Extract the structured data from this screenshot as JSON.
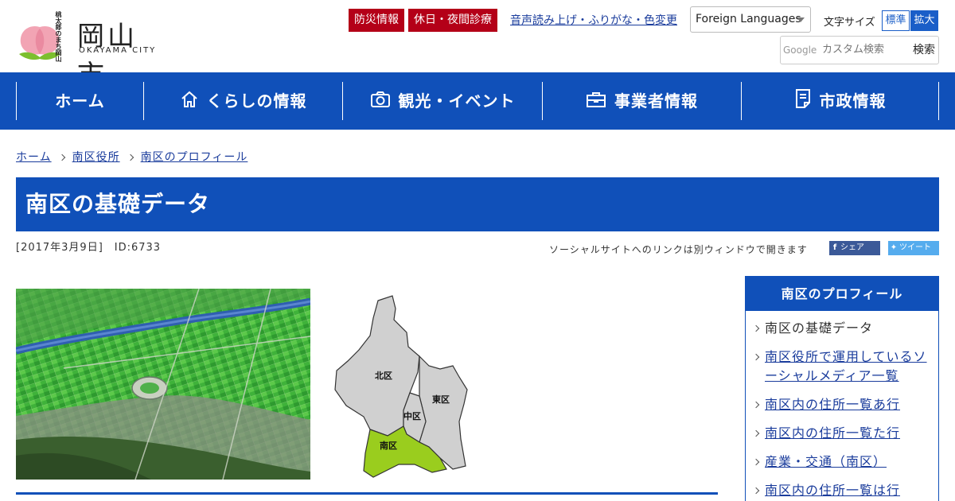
{
  "header": {
    "logo_city": "岡山市",
    "logo_en": "OKAYAMA CITY",
    "logo_vertical": "桃太郎のまち岡山",
    "disaster_label": "防災情報",
    "holiday_label": "休日・夜間診療",
    "voice_label": "音声読み上げ・ふりがな・色変更",
    "lang_label": "Foreign Languages",
    "fontsize_label": "文字サイズ",
    "fontsize_std": "標準",
    "fontsize_big": "拡大",
    "search_brand": "Google",
    "search_placeholder": "カスタム検索",
    "search_button": "検索"
  },
  "nav": {
    "home": "ホーム",
    "life": "くらしの情報",
    "tourism": "観光・イベント",
    "business": "事業者情報",
    "city": "市政情報"
  },
  "breadcrumb": [
    "ホーム",
    "南区役所",
    "南区のプロフィール"
  ],
  "page": {
    "title": "南区の基礎データ",
    "meta": "[2017年3月9日]　ID:6733",
    "social_note": "ソーシャルサイトへのリンクは別ウィンドウで開きます",
    "share_fb": "シェア",
    "share_tw": "ツイート"
  },
  "map": {
    "labels": [
      "北区",
      "東区",
      "中区",
      "南区"
    ],
    "colors": {
      "other": "#d0d0d0",
      "highlight": "#9acd1e"
    }
  },
  "sidebar": {
    "title": "南区のプロフィール",
    "items": [
      "南区の基礎データ",
      "南区役所で運用しているソーシャルメディア一覧",
      "南区内の住所一覧あ行",
      "南区内の住所一覧た行",
      "産業・交通（南区）",
      "南区内の住所一覧は行"
    ]
  },
  "colors": {
    "brand": "#1050b9",
    "alert": "#b40018"
  }
}
